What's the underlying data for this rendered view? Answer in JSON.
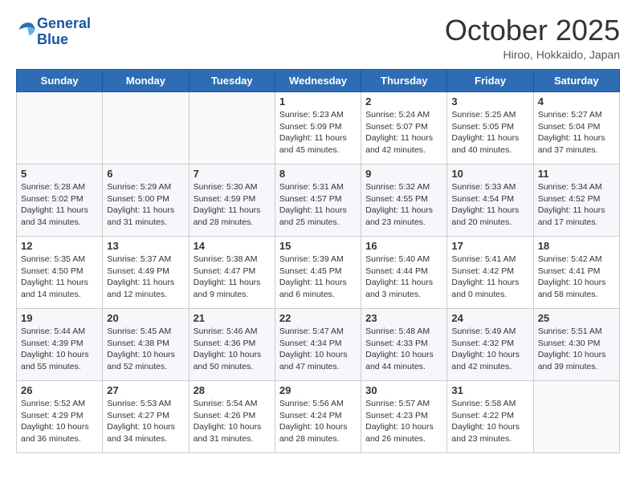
{
  "logo": {
    "line1": "General",
    "line2": "Blue"
  },
  "title": "October 2025",
  "subtitle": "Hiroo, Hokkaido, Japan",
  "weekdays": [
    "Sunday",
    "Monday",
    "Tuesday",
    "Wednesday",
    "Thursday",
    "Friday",
    "Saturday"
  ],
  "weeks": [
    [
      {
        "day": "",
        "sunrise": "",
        "sunset": "",
        "daylight": ""
      },
      {
        "day": "",
        "sunrise": "",
        "sunset": "",
        "daylight": ""
      },
      {
        "day": "",
        "sunrise": "",
        "sunset": "",
        "daylight": ""
      },
      {
        "day": "1",
        "sunrise": "Sunrise: 5:23 AM",
        "sunset": "Sunset: 5:09 PM",
        "daylight": "Daylight: 11 hours and 45 minutes."
      },
      {
        "day": "2",
        "sunrise": "Sunrise: 5:24 AM",
        "sunset": "Sunset: 5:07 PM",
        "daylight": "Daylight: 11 hours and 42 minutes."
      },
      {
        "day": "3",
        "sunrise": "Sunrise: 5:25 AM",
        "sunset": "Sunset: 5:05 PM",
        "daylight": "Daylight: 11 hours and 40 minutes."
      },
      {
        "day": "4",
        "sunrise": "Sunrise: 5:27 AM",
        "sunset": "Sunset: 5:04 PM",
        "daylight": "Daylight: 11 hours and 37 minutes."
      }
    ],
    [
      {
        "day": "5",
        "sunrise": "Sunrise: 5:28 AM",
        "sunset": "Sunset: 5:02 PM",
        "daylight": "Daylight: 11 hours and 34 minutes."
      },
      {
        "day": "6",
        "sunrise": "Sunrise: 5:29 AM",
        "sunset": "Sunset: 5:00 PM",
        "daylight": "Daylight: 11 hours and 31 minutes."
      },
      {
        "day": "7",
        "sunrise": "Sunrise: 5:30 AM",
        "sunset": "Sunset: 4:59 PM",
        "daylight": "Daylight: 11 hours and 28 minutes."
      },
      {
        "day": "8",
        "sunrise": "Sunrise: 5:31 AM",
        "sunset": "Sunset: 4:57 PM",
        "daylight": "Daylight: 11 hours and 25 minutes."
      },
      {
        "day": "9",
        "sunrise": "Sunrise: 5:32 AM",
        "sunset": "Sunset: 4:55 PM",
        "daylight": "Daylight: 11 hours and 23 minutes."
      },
      {
        "day": "10",
        "sunrise": "Sunrise: 5:33 AM",
        "sunset": "Sunset: 4:54 PM",
        "daylight": "Daylight: 11 hours and 20 minutes."
      },
      {
        "day": "11",
        "sunrise": "Sunrise: 5:34 AM",
        "sunset": "Sunset: 4:52 PM",
        "daylight": "Daylight: 11 hours and 17 minutes."
      }
    ],
    [
      {
        "day": "12",
        "sunrise": "Sunrise: 5:35 AM",
        "sunset": "Sunset: 4:50 PM",
        "daylight": "Daylight: 11 hours and 14 minutes."
      },
      {
        "day": "13",
        "sunrise": "Sunrise: 5:37 AM",
        "sunset": "Sunset: 4:49 PM",
        "daylight": "Daylight: 11 hours and 12 minutes."
      },
      {
        "day": "14",
        "sunrise": "Sunrise: 5:38 AM",
        "sunset": "Sunset: 4:47 PM",
        "daylight": "Daylight: 11 hours and 9 minutes."
      },
      {
        "day": "15",
        "sunrise": "Sunrise: 5:39 AM",
        "sunset": "Sunset: 4:45 PM",
        "daylight": "Daylight: 11 hours and 6 minutes."
      },
      {
        "day": "16",
        "sunrise": "Sunrise: 5:40 AM",
        "sunset": "Sunset: 4:44 PM",
        "daylight": "Daylight: 11 hours and 3 minutes."
      },
      {
        "day": "17",
        "sunrise": "Sunrise: 5:41 AM",
        "sunset": "Sunset: 4:42 PM",
        "daylight": "Daylight: 11 hours and 0 minutes."
      },
      {
        "day": "18",
        "sunrise": "Sunrise: 5:42 AM",
        "sunset": "Sunset: 4:41 PM",
        "daylight": "Daylight: 10 hours and 58 minutes."
      }
    ],
    [
      {
        "day": "19",
        "sunrise": "Sunrise: 5:44 AM",
        "sunset": "Sunset: 4:39 PM",
        "daylight": "Daylight: 10 hours and 55 minutes."
      },
      {
        "day": "20",
        "sunrise": "Sunrise: 5:45 AM",
        "sunset": "Sunset: 4:38 PM",
        "daylight": "Daylight: 10 hours and 52 minutes."
      },
      {
        "day": "21",
        "sunrise": "Sunrise: 5:46 AM",
        "sunset": "Sunset: 4:36 PM",
        "daylight": "Daylight: 10 hours and 50 minutes."
      },
      {
        "day": "22",
        "sunrise": "Sunrise: 5:47 AM",
        "sunset": "Sunset: 4:34 PM",
        "daylight": "Daylight: 10 hours and 47 minutes."
      },
      {
        "day": "23",
        "sunrise": "Sunrise: 5:48 AM",
        "sunset": "Sunset: 4:33 PM",
        "daylight": "Daylight: 10 hours and 44 minutes."
      },
      {
        "day": "24",
        "sunrise": "Sunrise: 5:49 AM",
        "sunset": "Sunset: 4:32 PM",
        "daylight": "Daylight: 10 hours and 42 minutes."
      },
      {
        "day": "25",
        "sunrise": "Sunrise: 5:51 AM",
        "sunset": "Sunset: 4:30 PM",
        "daylight": "Daylight: 10 hours and 39 minutes."
      }
    ],
    [
      {
        "day": "26",
        "sunrise": "Sunrise: 5:52 AM",
        "sunset": "Sunset: 4:29 PM",
        "daylight": "Daylight: 10 hours and 36 minutes."
      },
      {
        "day": "27",
        "sunrise": "Sunrise: 5:53 AM",
        "sunset": "Sunset: 4:27 PM",
        "daylight": "Daylight: 10 hours and 34 minutes."
      },
      {
        "day": "28",
        "sunrise": "Sunrise: 5:54 AM",
        "sunset": "Sunset: 4:26 PM",
        "daylight": "Daylight: 10 hours and 31 minutes."
      },
      {
        "day": "29",
        "sunrise": "Sunrise: 5:56 AM",
        "sunset": "Sunset: 4:24 PM",
        "daylight": "Daylight: 10 hours and 28 minutes."
      },
      {
        "day": "30",
        "sunrise": "Sunrise: 5:57 AM",
        "sunset": "Sunset: 4:23 PM",
        "daylight": "Daylight: 10 hours and 26 minutes."
      },
      {
        "day": "31",
        "sunrise": "Sunrise: 5:58 AM",
        "sunset": "Sunset: 4:22 PM",
        "daylight": "Daylight: 10 hours and 23 minutes."
      },
      {
        "day": "",
        "sunrise": "",
        "sunset": "",
        "daylight": ""
      }
    ]
  ]
}
